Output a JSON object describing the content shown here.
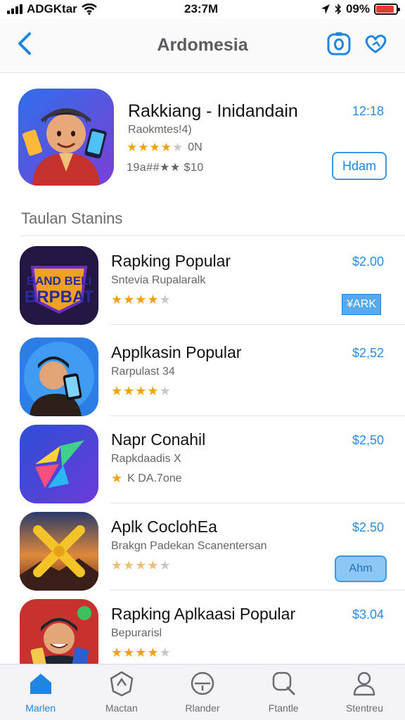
{
  "status_bar": {
    "carrier": "ADGKtar",
    "time": "23:7M",
    "battery_text": "09%",
    "battery_level": 0.9
  },
  "nav": {
    "title": "Ardomesia"
  },
  "featured": {
    "title": "Rakkiang - Inidandain",
    "subtitle": "Raokmtes!4)",
    "rating_text": "0N",
    "rating": 4,
    "meta": "19a##★★ $10",
    "price": "12:18",
    "button_label": "Hdam"
  },
  "section": {
    "title": "Taulan Stanins"
  },
  "apps": [
    {
      "title": "Rapking Popular",
      "subtitle": "Sntevia Rupalaralk",
      "rating": 4,
      "rating_text": "",
      "price": "$2.00",
      "button_label": "¥ARK",
      "button_style": "badge",
      "icon_text": "BAND BELI BRPBAT"
    },
    {
      "title": "Applkasin Popular",
      "subtitle": "Rarpulast 34",
      "rating": 4,
      "rating_text": "",
      "price": "$2,52",
      "button_label": "",
      "button_style": "none"
    },
    {
      "title": "Napr Conahil",
      "subtitle": "Rapkdaadis X",
      "rating": 1,
      "rating_text": "K DA.7one",
      "price": "$2,50",
      "button_label": "",
      "button_style": "none"
    },
    {
      "title": "Aplk CoclohEa",
      "subtitle": "Brakgn Padekan Scanentersan",
      "rating": 4,
      "rating_text": "",
      "price": "$2.50",
      "button_label": "Ahm",
      "button_style": "pill"
    },
    {
      "title": "Rapking Aplkaasi Popular",
      "subtitle": "Bepurarisl",
      "rating": 4,
      "rating_text": "",
      "price": "$3.04",
      "button_label": "",
      "button_style": "none"
    }
  ],
  "tabs": [
    {
      "label": "Marlen",
      "icon": "home-icon",
      "active": true
    },
    {
      "label": "Mactan",
      "icon": "shield-icon",
      "active": false
    },
    {
      "label": "Rlander",
      "icon": "compass-icon",
      "active": false
    },
    {
      "label": "Ftantle",
      "icon": "search-icon",
      "active": false
    },
    {
      "label": "Stentreu",
      "icon": "person-icon",
      "active": false
    }
  ],
  "colors": {
    "accent": "#1e86e0",
    "price": "#2b8be3",
    "star": "#f2a20e",
    "battery": "#e53a2f"
  }
}
